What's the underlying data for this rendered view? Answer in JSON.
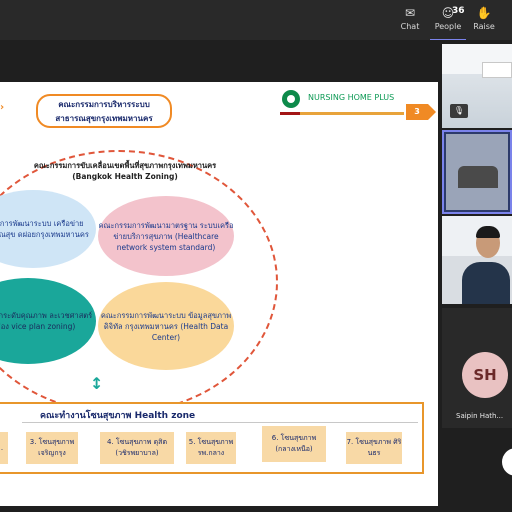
{
  "topbar": {
    "chat_label": "Chat",
    "people_label": "People",
    "people_count": "36",
    "raise_label": "Raise"
  },
  "slide": {
    "header_line1": "คณะกรรมการบริหารระบบ",
    "header_line2": "สาธารณสุขกรุงเทพมหานคร",
    "brand": "NURSING HOME PLUS",
    "page_number": "3",
    "zoning_title_th": "คณะกรรมการขับเคลื่อนเขตพื้นที่สุขภาพกรุงเทพมหานคร",
    "zoning_title_en": "(Bangkok Health Zoning)",
    "circles": [
      {
        "text": "กรรมการพัฒนาระบบ เครือข่ายสาธารณสุข ดฝอยกรุงเทพมหานคร"
      },
      {
        "text": "คณะกรรมการพัฒนามาตรฐาน ระบบเครือข่ายบริการสุขภาพ (Healthcare network system standard)"
      },
      {
        "text": "กรรมการยกระดับคุณภาพ ละเวชศาสตร์เขตเมือง vice plan zoning)"
      },
      {
        "text": "คณะกรรมการพัฒนาระบบ ข้อมูลสุขภาพดิจิทัล กรุงเทพมหานคร (Health Data Center)"
      }
    ],
    "zone_section_title": "คณะทำงานโซนสุขภาพ  Health zone",
    "zones": [
      {
        "label": "."
      },
      {
        "label": "3. โซนสุขภาพ เจริญกรุง"
      },
      {
        "label": "4. โซนสุขภาพ ดุสิต (วชิรพยาบาล)"
      },
      {
        "label": "5. โซนสุขภาพ รพ.กลาง"
      },
      {
        "label": "6. โซนสุขภาพ (กลางเหนือ)"
      },
      {
        "label": "7. โซนสุขภาพ ศิรินธร"
      }
    ]
  },
  "participants": {
    "initials": "SH",
    "name": "Saipin Hath..."
  },
  "colors": {
    "accent": "#f08a24",
    "teal": "#1aa79a",
    "teams_purple": "#7b83eb"
  }
}
